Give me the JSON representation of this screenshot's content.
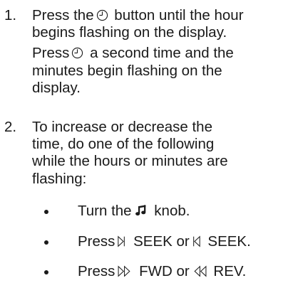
{
  "steps": [
    {
      "number": "1.",
      "paragraphs": [
        {
          "before_icon": "Press the",
          "icon": "clock-icon",
          "after_icon_line1": " button until the hour",
          "continuation": "begins flashing on the display."
        },
        {
          "before_icon": "Press",
          "icon": "clock-icon",
          "after_icon_line1": " a second time and the",
          "continuation_lines": [
            "minutes begin flashing on the",
            "display."
          ]
        }
      ]
    },
    {
      "number": "2.",
      "lines": [
        "To increase or decrease the",
        "time, do one of the following",
        "while the hours or minutes are",
        "flashing:"
      ]
    }
  ],
  "bullets": [
    {
      "before": "Turn the",
      "icon": "music-note-icon",
      "after": " knob."
    },
    {
      "before": "Press",
      "icon1": "seek-forward-icon",
      "mid": " SEEK or",
      "icon2": "seek-back-icon",
      "after": " SEEK."
    },
    {
      "before": "Press",
      "icon1": "fast-forward-icon",
      "mid": " FWD or",
      "icon2": "rewind-icon",
      "after": " REV."
    }
  ],
  "colors": {
    "text": "#1a1a1a",
    "background": "#ffffff"
  }
}
